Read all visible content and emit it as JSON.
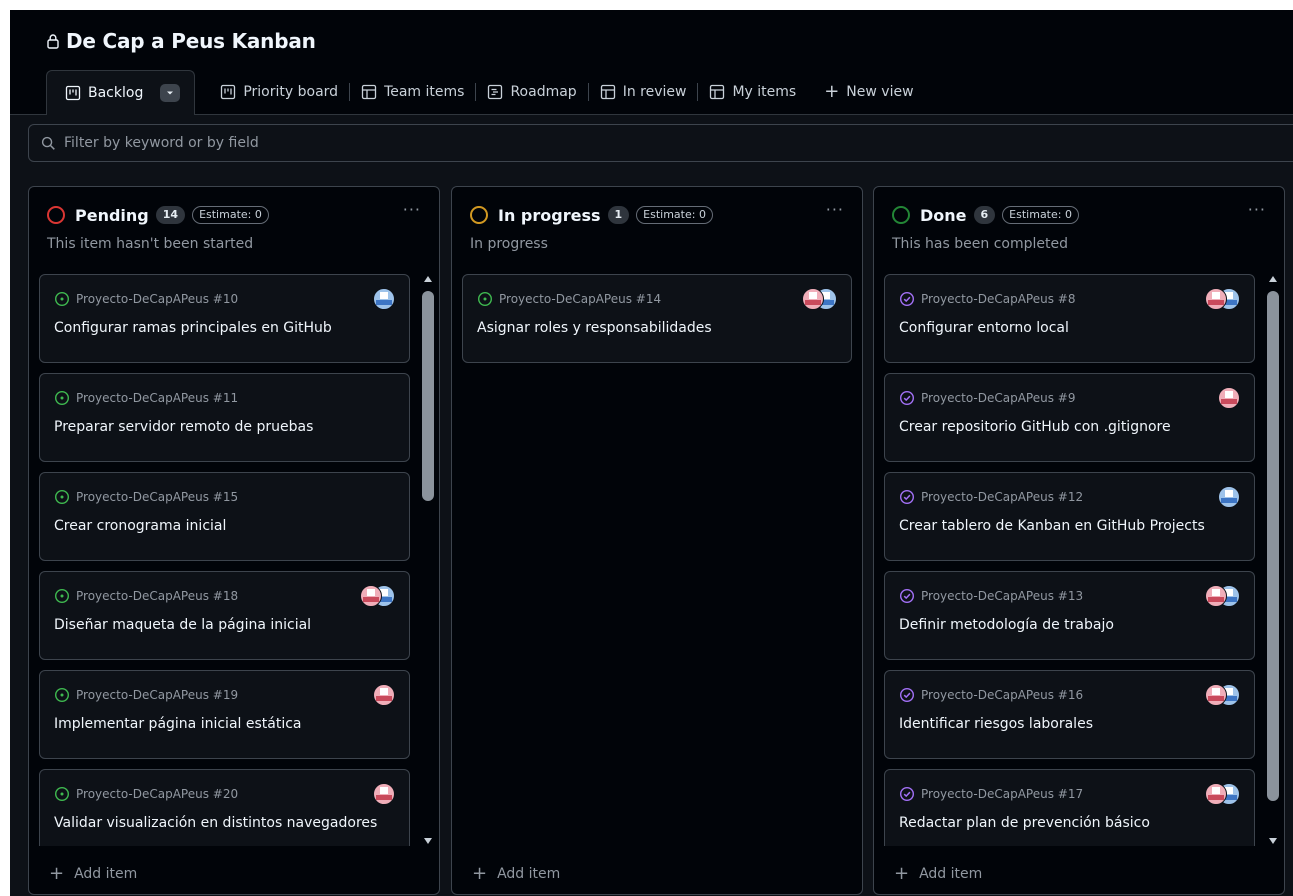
{
  "project": {
    "title": "De Cap a Peus Kanban"
  },
  "tabs": [
    {
      "label": "Backlog",
      "icon": "board-icon",
      "active": true
    },
    {
      "label": "Priority board",
      "icon": "board-icon"
    },
    {
      "label": "Team items",
      "icon": "table-icon"
    },
    {
      "label": "Roadmap",
      "icon": "roadmap-icon"
    },
    {
      "label": "In review",
      "icon": "table-icon"
    },
    {
      "label": "My items",
      "icon": "table-icon"
    }
  ],
  "new_view_label": "New view",
  "filter": {
    "placeholder": "Filter by keyword or by field"
  },
  "colors": {
    "pending": "#da3633",
    "in_progress": "#d29922",
    "done": "#238636",
    "open_issue": "#3fb950",
    "closed_issue": "#a371f7"
  },
  "columns": [
    {
      "name": "Pending",
      "count": "14",
      "estimate": "Estimate: 0",
      "description": "This item hasn't been started",
      "add_item": "Add item",
      "cards": [
        {
          "ref": "Proyecto-DeCapAPeus #10",
          "title": "Configurar ramas principales en GitHub",
          "state": "open",
          "avatars": [
            "blue"
          ]
        },
        {
          "ref": "Proyecto-DeCapAPeus #11",
          "title": "Preparar servidor remoto de pruebas",
          "state": "open",
          "avatars": []
        },
        {
          "ref": "Proyecto-DeCapAPeus #15",
          "title": "Crear cronograma inicial",
          "state": "open",
          "avatars": []
        },
        {
          "ref": "Proyecto-DeCapAPeus #18",
          "title": "Diseñar maqueta de la página inicial",
          "state": "open",
          "avatars": [
            "blue",
            "pink"
          ]
        },
        {
          "ref": "Proyecto-DeCapAPeus #19",
          "title": "Implementar página inicial estática",
          "state": "open",
          "avatars": [
            "pink"
          ]
        },
        {
          "ref": "Proyecto-DeCapAPeus #20",
          "title": "Validar visualización en distintos navegadores",
          "state": "open",
          "avatars": [
            "pink"
          ]
        }
      ]
    },
    {
      "name": "In progress",
      "count": "1",
      "estimate": "Estimate: 0",
      "description": "In progress",
      "add_item": "Add item",
      "cards": [
        {
          "ref": "Proyecto-DeCapAPeus #14",
          "title": "Asignar roles y responsabilidades",
          "state": "open",
          "avatars": [
            "blue",
            "pink"
          ]
        }
      ]
    },
    {
      "name": "Done",
      "count": "6",
      "estimate": "Estimate: 0",
      "description": "This has been completed",
      "add_item": "Add item",
      "cards": [
        {
          "ref": "Proyecto-DeCapAPeus #8",
          "title": "Configurar entorno local",
          "state": "closed",
          "avatars": [
            "blue",
            "pink"
          ]
        },
        {
          "ref": "Proyecto-DeCapAPeus #9",
          "title": "Crear repositorio GitHub con .gitignore",
          "state": "closed",
          "avatars": [
            "pink"
          ]
        },
        {
          "ref": "Proyecto-DeCapAPeus #12",
          "title": "Crear tablero de Kanban en GitHub Projects",
          "state": "closed",
          "avatars": [
            "blue"
          ]
        },
        {
          "ref": "Proyecto-DeCapAPeus #13",
          "title": "Definir metodología de trabajo",
          "state": "closed",
          "avatars": [
            "blue",
            "pink"
          ]
        },
        {
          "ref": "Proyecto-DeCapAPeus #16",
          "title": "Identificar riesgos laborales",
          "state": "closed",
          "avatars": [
            "blue",
            "pink"
          ]
        },
        {
          "ref": "Proyecto-DeCapAPeus #17",
          "title": "Redactar plan de prevención básico",
          "state": "closed",
          "avatars": [
            "blue",
            "pink"
          ]
        }
      ]
    }
  ]
}
